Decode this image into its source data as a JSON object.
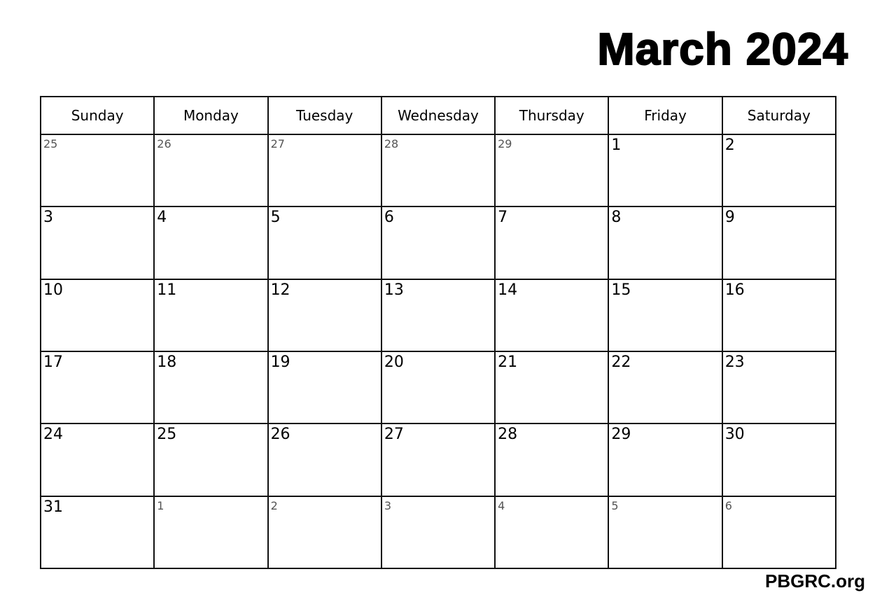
{
  "title": "March 2024",
  "weekdays": [
    "Sunday",
    "Monday",
    "Tuesday",
    "Wednesday",
    "Thursday",
    "Friday",
    "Saturday"
  ],
  "weeks": [
    [
      {
        "d": "25",
        "other": true
      },
      {
        "d": "26",
        "other": true
      },
      {
        "d": "27",
        "other": true
      },
      {
        "d": "28",
        "other": true
      },
      {
        "d": "29",
        "other": true
      },
      {
        "d": "1"
      },
      {
        "d": "2"
      }
    ],
    [
      {
        "d": "3"
      },
      {
        "d": "4"
      },
      {
        "d": "5"
      },
      {
        "d": "6"
      },
      {
        "d": "7"
      },
      {
        "d": "8"
      },
      {
        "d": "9"
      }
    ],
    [
      {
        "d": "10"
      },
      {
        "d": "11"
      },
      {
        "d": "12"
      },
      {
        "d": "13"
      },
      {
        "d": "14"
      },
      {
        "d": "15"
      },
      {
        "d": "16"
      }
    ],
    [
      {
        "d": "17"
      },
      {
        "d": "18"
      },
      {
        "d": "19"
      },
      {
        "d": "20"
      },
      {
        "d": "21"
      },
      {
        "d": "22"
      },
      {
        "d": "23"
      }
    ],
    [
      {
        "d": "24"
      },
      {
        "d": "25"
      },
      {
        "d": "26"
      },
      {
        "d": "27"
      },
      {
        "d": "28"
      },
      {
        "d": "29"
      },
      {
        "d": "30"
      }
    ],
    [
      {
        "d": "31"
      },
      {
        "d": "1",
        "other": true
      },
      {
        "d": "2",
        "other": true
      },
      {
        "d": "3",
        "other": true
      },
      {
        "d": "4",
        "other": true
      },
      {
        "d": "5",
        "other": true
      },
      {
        "d": "6",
        "other": true
      }
    ]
  ],
  "footer": "PBGRC.org"
}
